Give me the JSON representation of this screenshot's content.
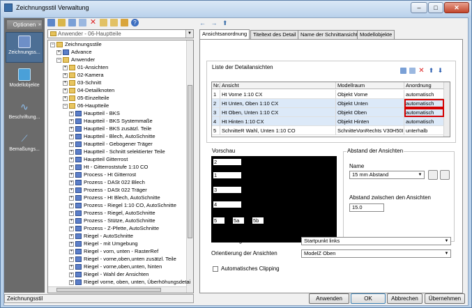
{
  "window": {
    "title": "Zeichnungsstil Verwaltung",
    "min": "–",
    "max": "□",
    "close": "✕"
  },
  "sidebar": {
    "header": "Optionen",
    "pin": "»",
    "items": [
      {
        "label": "Zeichnungss...",
        "icon": "drawing-style-icon"
      },
      {
        "label": "Modellobjekte",
        "icon": "model-objects-icon"
      },
      {
        "label": "Beschriftung...",
        "icon": "annotation-icon"
      },
      {
        "label": "Bemaßungs...",
        "icon": "dimension-icon"
      }
    ]
  },
  "toolbar": {
    "icons": [
      "new-icon",
      "edit-icon",
      "copy-icon",
      "paste-icon",
      "delete-icon",
      "import-icon",
      "export-icon",
      "folder-icon",
      "help-icon"
    ]
  },
  "source_combo": {
    "value": "Anwender - 06-Hauptteile"
  },
  "tree": {
    "root": "Zeichnungsstile",
    "items": [
      {
        "label": "Zeichnungsstile",
        "level": 0,
        "exp": "−",
        "icon": "folder"
      },
      {
        "label": "Advance",
        "level": 1,
        "exp": "+",
        "icon": "doc"
      },
      {
        "label": "Anwender",
        "level": 1,
        "exp": "−",
        "icon": "folder"
      },
      {
        "label": "01-Ansichten",
        "level": 2,
        "exp": "+",
        "icon": "folder"
      },
      {
        "label": "02-Kamera",
        "level": 2,
        "exp": "+",
        "icon": "folder"
      },
      {
        "label": "03-Schnitt",
        "level": 2,
        "exp": "+",
        "icon": "folder"
      },
      {
        "label": "04-Detailknoten",
        "level": 2,
        "exp": "+",
        "icon": "folder"
      },
      {
        "label": "05-Einzelteile",
        "level": 2,
        "exp": "+",
        "icon": "folder"
      },
      {
        "label": "06-Hauptteile",
        "level": 2,
        "exp": "−",
        "icon": "folder"
      },
      {
        "label": "Hauptteil - BKS",
        "level": 3,
        "exp": "+",
        "icon": "doc"
      },
      {
        "label": "Hauptteil - BKS Systemmaße",
        "level": 3,
        "exp": "+",
        "icon": "doc"
      },
      {
        "label": "Hauptteil - BKS zusätzl. Teile",
        "level": 3,
        "exp": "+",
        "icon": "doc"
      },
      {
        "label": "Hauptteil - Blech, AutoSchnitte",
        "level": 3,
        "exp": "+",
        "icon": "doc"
      },
      {
        "label": "Hauptteil - Gebogener Träger",
        "level": 3,
        "exp": "+",
        "icon": "doc"
      },
      {
        "label": "Hauptteil - Schnitt selektierter Teile",
        "level": 3,
        "exp": "+",
        "icon": "doc"
      },
      {
        "label": "Hauptteil Gitterrost",
        "level": 3,
        "exp": "+",
        "icon": "doc"
      },
      {
        "label": "Ht - Gitterroststufe 1:10 CO",
        "level": 3,
        "exp": "+",
        "icon": "doc"
      },
      {
        "label": "Process - Ht Gitterrost",
        "level": 3,
        "exp": "+",
        "icon": "doc"
      },
      {
        "label": "Prozess - DASt 022 Blech",
        "level": 3,
        "exp": "+",
        "icon": "doc"
      },
      {
        "label": "Prozess - DASt 022 Träger",
        "level": 3,
        "exp": "+",
        "icon": "doc"
      },
      {
        "label": "Prozess - Ht Blech, AutoSchnitte",
        "level": 3,
        "exp": "+",
        "icon": "doc"
      },
      {
        "label": "Prozess - Riegel 1:10 CO, AutoSchnitte",
        "level": 3,
        "exp": "+",
        "icon": "doc"
      },
      {
        "label": "Prozess - Riegel, AutoSchnitte",
        "level": 3,
        "exp": "+",
        "icon": "doc"
      },
      {
        "label": "Prozess - Stütze, AutoSchnitte",
        "level": 3,
        "exp": "+",
        "icon": "doc"
      },
      {
        "label": "Prozess - Z-Pfette, AutoSchnitte",
        "level": 3,
        "exp": "+",
        "icon": "doc"
      },
      {
        "label": "Riegel - AutoSchnitte",
        "level": 3,
        "exp": "+",
        "icon": "doc"
      },
      {
        "label": "Riegel - mit Umgebung",
        "level": 3,
        "exp": "+",
        "icon": "doc"
      },
      {
        "label": "Riegel - vorn, unten - RasterRef",
        "level": 3,
        "exp": "+",
        "icon": "doc"
      },
      {
        "label": "Riegel - vorne,oben,unten zusätzl. Teile",
        "level": 3,
        "exp": "+",
        "icon": "doc"
      },
      {
        "label": "Riegel - vorne,oben,unten, hinten",
        "level": 3,
        "exp": "+",
        "icon": "doc"
      },
      {
        "label": "Riegel - Wahl der Ansichten",
        "level": 3,
        "exp": "+",
        "icon": "doc"
      },
      {
        "label": "Riegel vorne, oben, unten, Überhöhungsdetai",
        "level": 3,
        "exp": "+",
        "icon": "doc"
      }
    ]
  },
  "nav": {
    "back": "←",
    "forward": "→",
    "up": "⬆"
  },
  "tabs": [
    "Ansichtsanordnung",
    "Titeltext des Detail",
    "Name der Schnittansicht",
    "Modellobjekte"
  ],
  "detail_list": {
    "group_label": "Liste der Detailansichten",
    "tool_icons": [
      "copy-row-icon",
      "paste-row-icon",
      "delete-row-icon",
      "move-up-icon",
      "move-down-icon"
    ],
    "columns": [
      "Nr.",
      "Ansicht",
      "Modellraum",
      "Anordnung"
    ],
    "rows": [
      {
        "nr": "1",
        "ansicht": "Ht Vorne 1:10 CX",
        "modellraum": "Objekt Vorne",
        "anordnung": "automatisch"
      },
      {
        "nr": "2",
        "ansicht": "Ht Unten, Oben 1:10 CX",
        "modellraum": "Objekt Unten",
        "anordnung": "automatisch"
      },
      {
        "nr": "3",
        "ansicht": "Ht Oben, Unten 1:10 CX",
        "modellraum": "Objekt Oben",
        "anordnung": "automatisch"
      },
      {
        "nr": "4",
        "ansicht": "Ht Hinten 1:10 CX",
        "modellraum": "Objekt Hinten",
        "anordnung": "automatisch"
      },
      {
        "nr": "5",
        "ansicht": "SchnitteR Wahl, Unten 1:10 CO",
        "modellraum": "SchnitteVonRechts V30H50I",
        "anordnung": "unterhalb"
      }
    ]
  },
  "preview": {
    "label": "Vorschau",
    "boxes": [
      "2",
      "1",
      "3",
      "4",
      "5",
      "5a",
      "5b"
    ]
  },
  "spacing": {
    "group_label": "Abstand der Ansichten",
    "name_label": "Name",
    "name_value": "15 mm Abstand",
    "between_label": "Abstand zwischen den Ansichten",
    "between_value": "15.0"
  },
  "orientation": {
    "part_label": "Orientierung des Bauteils",
    "part_value": "Startpunkt links",
    "views_label": "Orientierung der Ansichten",
    "views_value": "ModelZ Oben"
  },
  "auto_clipping": {
    "label": "Automatisches Clipping",
    "checked": false
  },
  "status": {
    "text": "Zeichnungsstil"
  },
  "buttons": {
    "apply": "Anwenden",
    "ok": "OK",
    "cancel": "Abbrechen",
    "take": "Übernehmen"
  }
}
